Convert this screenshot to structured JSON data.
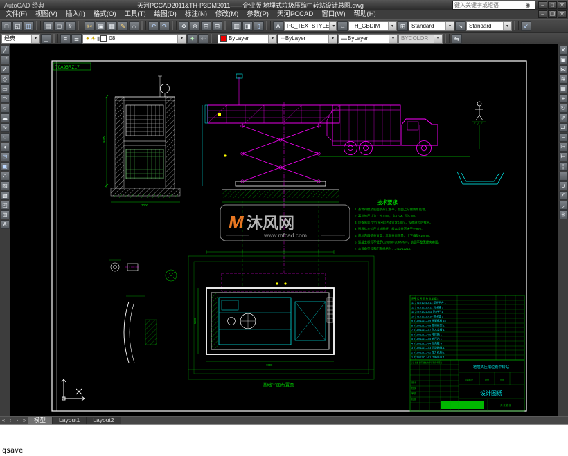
{
  "icons": {
    "search": "◉",
    "min": "–",
    "max": "□",
    "close": "✕",
    "docmax": "❐",
    "new": "□",
    "open": "◱",
    "save": "◫",
    "plot": "▤",
    "preview": "◻",
    "publish": "⇪",
    "cut": "✂",
    "copy": "▣",
    "paste": "▦",
    "matchprops": "✎",
    "blockedit": "⌂",
    "undo": "↶",
    "redo": "↷",
    "pan": "✥",
    "zoom": "⊕",
    "zoomwin": "⊞",
    "zoomprev": "⊟",
    "props": "▥",
    "dcenter": "◨",
    "palettes": "▯",
    "markup": "✓",
    "textstyle": "A",
    "dimstyle": "↔",
    "tablestyle": "⊞",
    "mleader": "↘",
    "savews": "◫",
    "layerprops": "≡",
    "layerstates": "≣",
    "makecurrent": "✦",
    "layerprev": "⇠",
    "bulb": "●",
    "sun": "☀",
    "lock": "▮",
    "arrowdn": "▾",
    "ltprev": "┄",
    "lwprev": "▬",
    "matchlayer": "⇋",
    "line": "╱",
    "xline": "⋰",
    "pline": "∠",
    "polygon": "◇",
    "rect": "▭",
    "arc": "◠",
    "circle": "○",
    "revcloud": "☁",
    "spline": "∿",
    "ellipse": "◌",
    "ellipsearc": "◖",
    "insertblock": "⊡",
    "makeblock": "▣",
    "point": "∴",
    "hatch": "▨",
    "gradient": "▩",
    "region": "◰",
    "table": "⊞",
    "mtext": "A",
    "erase": "✕",
    "copy2": "▣",
    "mirror": "⋈",
    "offset": "≋",
    "array": "▦",
    "move": "+",
    "rotate": "↻",
    "scale": "⇗",
    "stretch": "⇄",
    "lengthen": "−",
    "trim": "✂",
    "extend": "⊢",
    "breakpt": "¦",
    "break": "⌐",
    "join": "∪",
    "chamfer": "∠",
    "fillet": "◞",
    "explode": "✳",
    "tabstart": "«",
    "tabprev": "‹",
    "tabnext": "›",
    "tabend": "»"
  },
  "titlebar": {
    "workspace_label": "AutoCAD 经典",
    "doc_title": "天河PCCAD2011&TH-P3DM2011——企业版  地埋式垃圾压缩中转站设计总图.dwg",
    "search_placeholder": "键入关键字或短语"
  },
  "menubar": {
    "items": [
      "文件(F)",
      "视图(V)",
      "插入(I)",
      "格式(O)",
      "工具(T)",
      "绘图(D)",
      "标注(N)",
      "修改(M)",
      "参数(P)",
      "天河PCCAD",
      "窗口(W)",
      "帮助(H)"
    ]
  },
  "styles_toolbar": {
    "text_style": "PC_TEXTSTYLE",
    "dim_style": "TH_GBDIM",
    "table_style": "Standard",
    "mleader_style": "Standard"
  },
  "properties_toolbar": {
    "workspace": "经典",
    "layer_name": "08",
    "color": "ByLayer",
    "linetype": "ByLayer",
    "lineweight": "ByLayer",
    "plot_style": "BYCOLOR"
  },
  "layout_tabs": {
    "model": "模型",
    "layout1": "Layout1",
    "layout2": "Layout2"
  },
  "command_line": {
    "text": "qsave"
  },
  "colors": {
    "accent_green": "#00c000",
    "accent_cyan": "#00ffff",
    "accent_magenta": "#ff00ff",
    "watermark_orange": "#e87722"
  },
  "drawing": {
    "frame_label": "70A95RZ17",
    "watermark": {
      "logo": "M",
      "name": "沐风网",
      "url": "www.mfcad.com"
    },
    "tech_notes": {
      "title": "技术要求",
      "lines": [
        "1. 基坑四壁及底面须夯实整平，壁面上方做防水处理。",
        "2. 基坑的尺寸为：长7.0M，宽4.5M，深5.0M。",
        "3. 设备吊装尺寸(长×宽)为4m(含0.8m)，设备就位后找平。",
        "4. 预埋件定位尺寸按图纸，标高误差不大于±5mm。",
        "5. 基坑内四壁垂直度：三面垂直测量，上下偏差≤10mm。",
        "6. 混凝土标号不低于C20(fck=20KN/M²)，表面平整无蜂窝麻面。",
        "7. 本设备型号和配套规格为：JTZV12ZLJ。"
      ]
    },
    "plan_caption": "基础平面布置图",
    "dimensions": {
      "elev_height": "4500",
      "elev_width": "3000",
      "plan_width": "7000",
      "plan_depth": "5000"
    },
    "bom": {
      "header": "序号  代 号  名 称  数量 备注",
      "rows": [
        "13 JTZV12ZLJ-13 提升平台 1",
        "12 JTZV12ZLJ-12 污水箱 1",
        "11 JTZV12ZLJ-11 防护栏 1",
        "10 JTZV12ZLJ-10 排水管 2",
        "9  JTZV12ZLJ-09 地脚螺栓 16",
        "8  JTZV12ZLJ-08 预埋框架 1",
        "7  JTZV12ZLJ-07 防水盖板 1",
        "6  JTZV12ZLJ-06 电控箱 1",
        "5  JTZV12ZLJ-05 液压站 1",
        "4  JTZV12ZLJ-04 导向柱 4",
        "3  JTZV12ZLJ-03 垃圾箱体 1",
        "2  JTZV12ZLJ-02 举升机构 1",
        "1  JTZV12ZLJ-01 压缩装置 1"
      ]
    },
    "title_block": {
      "project": "地埋式压缩垃圾中转站",
      "sheet": "设计图纸",
      "header_row": "标记 处数 分区 更改文件号 签名 年月日",
      "left_fields": [
        "设计",
        "校核",
        "审核",
        "批准"
      ],
      "stage_label": "阶段标记",
      "weight_label": "质量",
      "scale_label": "比例",
      "sheet_count": "共 张 第 张"
    }
  }
}
